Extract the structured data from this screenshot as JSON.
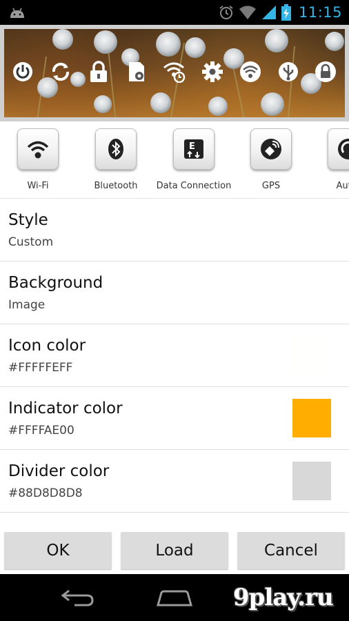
{
  "status_bar": {
    "time": "11:15",
    "icons": [
      "android-icon",
      "alarm-icon",
      "wifi-icon",
      "signal-icon",
      "battery-charging-icon"
    ],
    "accent_color": "#35b5e5"
  },
  "preview": {
    "icons": [
      "power-icon",
      "sync-icon",
      "lock-icon",
      "sd-card-settings-icon",
      "wifi-timer-icon",
      "gear-icon",
      "wifi-icon",
      "usb-icon",
      "screen-lock-icon"
    ],
    "indicator_color": "#FFAE00"
  },
  "toggles": [
    {
      "label": "Wi-Fi",
      "icon": "wifi-icon"
    },
    {
      "label": "Bluetooth",
      "icon": "bluetooth-icon"
    },
    {
      "label": "Data Connection",
      "icon": "data-connection-icon"
    },
    {
      "label": "GPS",
      "icon": "gps-icon"
    },
    {
      "label": "Auto-",
      "icon": "auto-rotate-icon"
    }
  ],
  "settings": [
    {
      "title": "Style",
      "value": "Custom"
    },
    {
      "title": "Background",
      "value": "Image"
    },
    {
      "title": "Icon color",
      "value": "#FFFFFEFF",
      "swatch": "#FFFFFE"
    },
    {
      "title": "Indicator color",
      "value": "#FFFFAE00",
      "swatch": "#FFAE00"
    },
    {
      "title": "Divider color",
      "value": "#88D8D8D8",
      "swatch": "#D8D8D8"
    }
  ],
  "buttons": {
    "ok": "OK",
    "load": "Load",
    "cancel": "Cancel"
  },
  "watermark": "9play.ru"
}
